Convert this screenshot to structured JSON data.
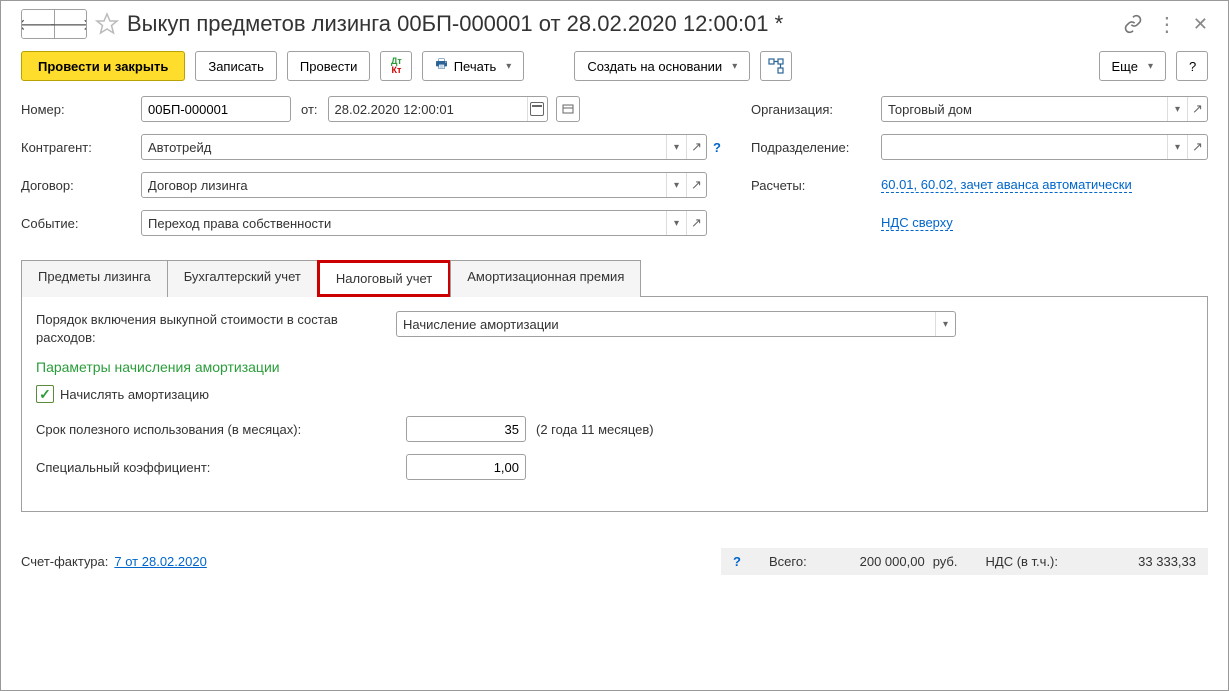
{
  "title": "Выкуп предметов лизинга 00БП-000001 от 28.02.2020 12:00:01 *",
  "toolbar": {
    "post_close": "Провести и закрыть",
    "write": "Записать",
    "post": "Провести",
    "print": "Печать",
    "create_based": "Создать на основании",
    "more": "Еще",
    "help": "?"
  },
  "form": {
    "number_label": "Номер:",
    "number": "00БП-000001",
    "from_label": "от:",
    "date": "28.02.2020 12:00:01",
    "counterparty_label": "Контрагент:",
    "counterparty": "Автотрейд",
    "contract_label": "Договор:",
    "contract": "Договор лизинга",
    "event_label": "Событие:",
    "event": "Переход права собственности",
    "org_label": "Организация:",
    "org": "Торговый дом",
    "division_label": "Подразделение:",
    "division": "",
    "calc_label": "Расчеты:",
    "calc_link": "60.01, 60.02, зачет аванса автоматически",
    "vat_link": "НДС сверху"
  },
  "tabs": [
    "Предметы лизинга",
    "Бухгалтерский учет",
    "Налоговый учет",
    "Амортизационная премия"
  ],
  "tax_tab": {
    "inclusion_label": "Порядок включения выкупной стоимости в состав расходов:",
    "inclusion_value": "Начисление амортизации",
    "section_title": "Параметры начисления амортизации",
    "accrue_label": "Начислять амортизацию",
    "life_label": "Срок полезного использования (в месяцах):",
    "life_value": "35",
    "life_hint": "(2 года 11 месяцев)",
    "coef_label": "Специальный коэффициент:",
    "coef_value": "1,00"
  },
  "footer": {
    "invoice_label": "Счет-фактура:",
    "invoice_link": "7 от 28.02.2020",
    "total_label": "Всего:",
    "total": "200 000,00",
    "currency": "руб.",
    "vat_label": "НДС (в т.ч.):",
    "vat": "33 333,33"
  }
}
